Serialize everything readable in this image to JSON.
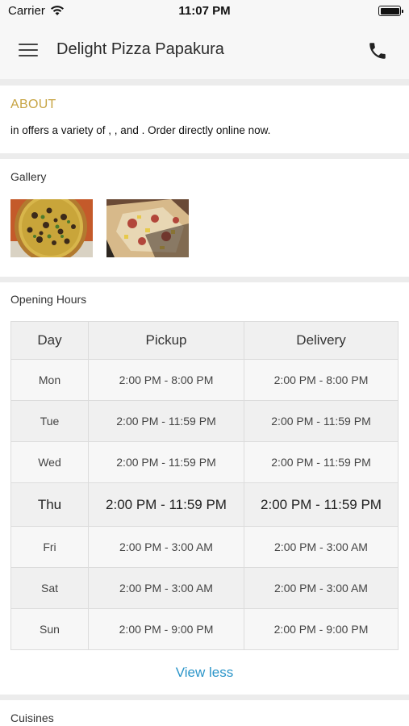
{
  "status_bar": {
    "carrier": "Carrier",
    "time": "11:07 PM"
  },
  "header": {
    "title": "Delight Pizza Papakura"
  },
  "about": {
    "title": "ABOUT",
    "text": "in  offers a variety of , ,  and  . Order directly online now."
  },
  "gallery": {
    "title": "Gallery"
  },
  "opening_hours": {
    "title": "Opening Hours",
    "columns": [
      "Day",
      "Pickup",
      "Delivery"
    ],
    "rows": [
      {
        "day": "Mon",
        "pickup": "2:00 PM - 8:00 PM",
        "delivery": "2:00 PM - 8:00 PM"
      },
      {
        "day": "Tue",
        "pickup": "2:00 PM - 11:59 PM",
        "delivery": "2:00 PM - 11:59 PM"
      },
      {
        "day": "Wed",
        "pickup": "2:00 PM - 11:59 PM",
        "delivery": "2:00 PM - 11:59 PM"
      },
      {
        "day": "Thu",
        "pickup": "2:00 PM - 11:59 PM",
        "delivery": "2:00 PM - 11:59 PM"
      },
      {
        "day": "Fri",
        "pickup": "2:00 PM - 3:00 AM",
        "delivery": "2:00 PM - 3:00 AM"
      },
      {
        "day": "Sat",
        "pickup": "2:00 PM - 3:00 AM",
        "delivery": "2:00 PM - 3:00 AM"
      },
      {
        "day": "Sun",
        "pickup": "2:00 PM - 9:00 PM",
        "delivery": "2:00 PM - 9:00 PM"
      }
    ],
    "view_less_label": "View less"
  },
  "cuisines": {
    "title": "Cuisines"
  },
  "colors": {
    "accent_gold": "#c7a443",
    "link_blue": "#2b95c9"
  }
}
